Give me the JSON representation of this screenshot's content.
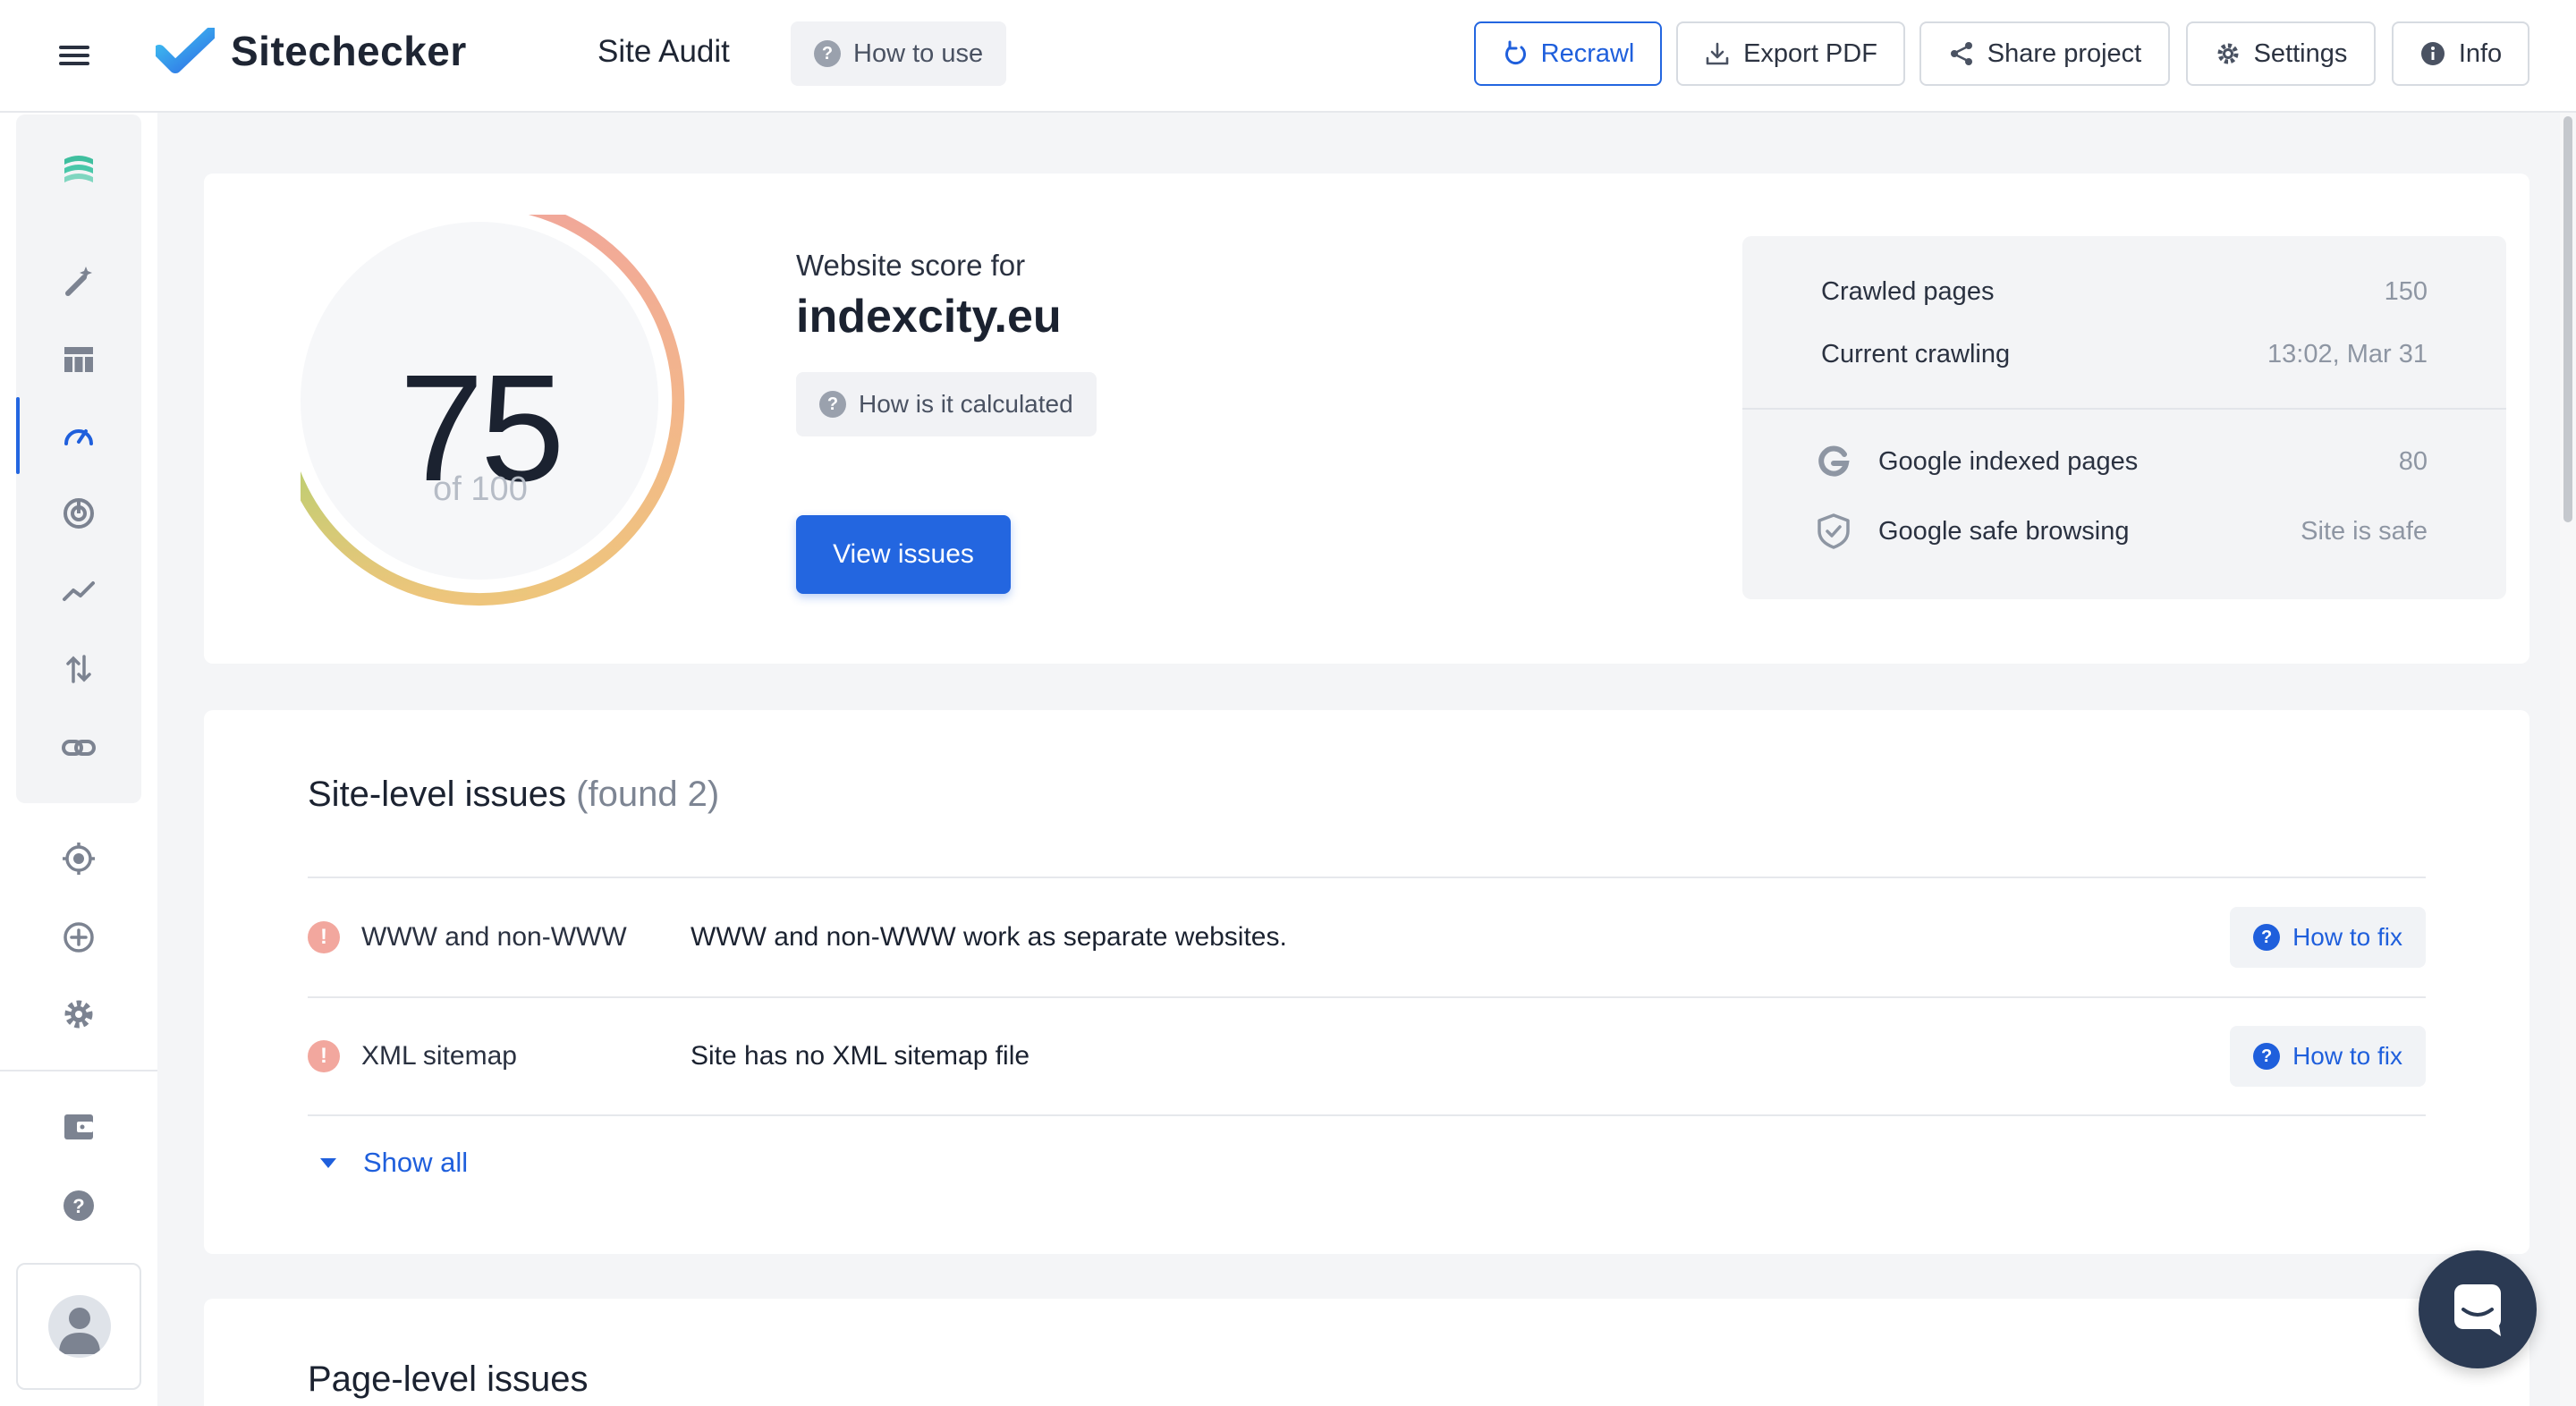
{
  "header": {
    "app_name": "Sitechecker",
    "page_title": "Site Audit",
    "how_to_use": "How to use",
    "buttons": {
      "recrawl": "Recrawl",
      "export_pdf": "Export PDF",
      "share": "Share project",
      "settings": "Settings",
      "info": "Info"
    }
  },
  "sidebar": {
    "items": [
      {
        "icon": "brand-waves-icon"
      },
      {
        "icon": "magic-wand-icon"
      },
      {
        "icon": "table-icon"
      },
      {
        "icon": "speedometer-icon",
        "active": true
      },
      {
        "icon": "radar-icon"
      },
      {
        "icon": "trend-line-icon"
      },
      {
        "icon": "sort-arrows-icon"
      },
      {
        "icon": "link-icon"
      },
      {
        "icon": "target-icon"
      },
      {
        "icon": "plus-circle-icon"
      },
      {
        "icon": "gear-icon"
      },
      {
        "icon": "wallet-icon"
      },
      {
        "icon": "help-icon"
      },
      {
        "icon": "user-avatar-icon"
      }
    ]
  },
  "score": {
    "value": "75",
    "of": "of 100",
    "fraction": 0.75,
    "label": "Website score for",
    "domain": "indexcity.eu",
    "calc_label": "How is it calculated",
    "view_issues": "View issues"
  },
  "stats": {
    "crawled_label": "Crawled pages",
    "crawled_value": "150",
    "current_label": "Current crawling",
    "current_value": "13:02, Mar 31",
    "google_label": "Google indexed pages",
    "google_value": "80",
    "safe_label": "Google safe browsing",
    "safe_value": "Site is safe"
  },
  "site_issues": {
    "title": "Site-level issues",
    "found": "(found 2)",
    "rows": [
      {
        "name": "WWW and non-WWW",
        "desc": "WWW and non-WWW work as separate websites.",
        "fix": "How to fix"
      },
      {
        "name": "XML sitemap",
        "desc": "Site has no XML sitemap file",
        "fix": "How to fix"
      }
    ],
    "show_all": "Show all"
  },
  "page_issues": {
    "title": "Page-level issues"
  },
  "colors": {
    "accent": "#2366e0",
    "error": "#f2a79e",
    "ring_start": "#9fd36a",
    "ring_mid": "#f0c27a",
    "ring_end": "#f1a79a"
  }
}
